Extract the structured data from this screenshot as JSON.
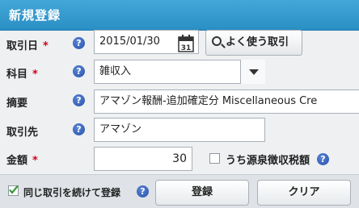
{
  "dialog": {
    "title": "新規登録"
  },
  "form": {
    "required_mark": "*",
    "help_glyph": "?",
    "date": {
      "label": "取引日",
      "value": "2015/01/30",
      "calendar_day": "31",
      "search_button": "よく使う取引"
    },
    "category": {
      "label": "科目",
      "value": "雑収入"
    },
    "description": {
      "label": "摘要",
      "value": "アマゾン報酬-追加確定分 Miscellaneous Cre"
    },
    "partner": {
      "label": "取引先",
      "value": "アマゾン"
    },
    "amount": {
      "label": "金額",
      "value": "30",
      "withholding_label": "うち源泉徴収税額",
      "withholding_checked": false
    }
  },
  "footer": {
    "continue_label": "同じ取引を続けて登録",
    "continue_checked": true,
    "register_button": "登録",
    "clear_button": "クリア"
  },
  "colors": {
    "title_bar": "#2f96cc",
    "required": "#d0021b",
    "help_icon": "#2751a8",
    "check": "#3a9a3a"
  }
}
